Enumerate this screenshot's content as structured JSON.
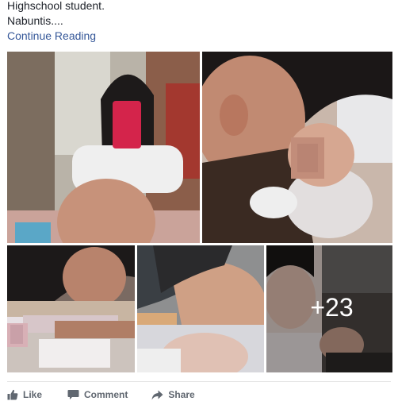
{
  "post": {
    "text_lines": [
      "Highschool student.",
      "Nabuntis...."
    ],
    "continue_label": "Continue Reading"
  },
  "photos": {
    "more_count": "+23"
  },
  "actions": {
    "like_label": "Like",
    "comment_label": "Comment",
    "share_label": "Share",
    "like_icon": "thumbs-up-icon",
    "comment_icon": "speech-bubble-icon",
    "share_icon": "share-arrow-icon"
  },
  "colors": {
    "link": "#365899",
    "action_text": "#606770",
    "body_text": "#1d2129",
    "divider": "#e5e5e5"
  }
}
